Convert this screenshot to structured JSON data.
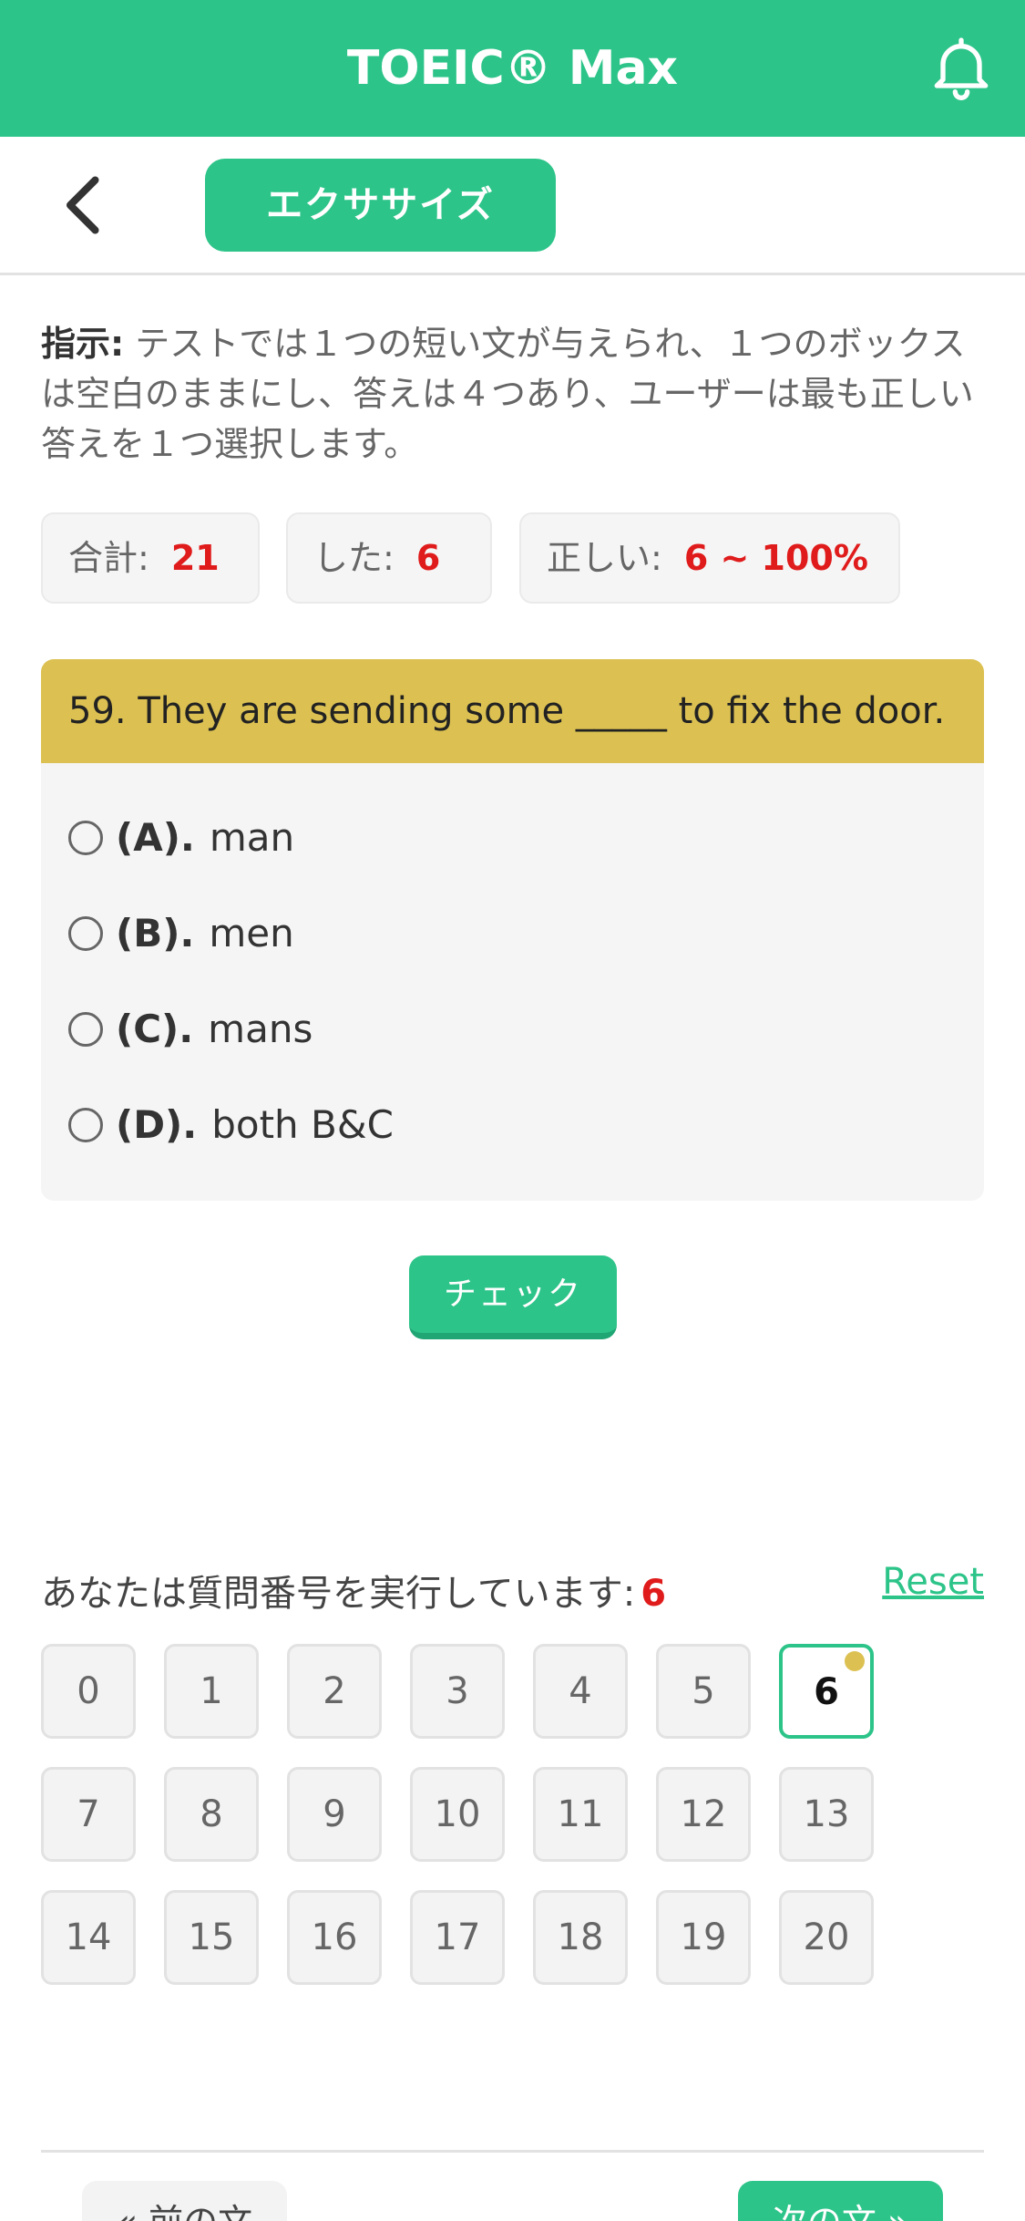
{
  "header": {
    "title": "TOEIC® Max",
    "icon": "bell-icon"
  },
  "subbar": {
    "back_icon": "chevron-left-icon",
    "mode_label": "エクササイズ"
  },
  "instruction": {
    "label": "指示:",
    "text": " テストでは１つの短い文が与えられ、１つのボックスは空白のままにし、答えは４つあり、ユーザーは最も正しい答えを１つ選択します。"
  },
  "stats": {
    "total_label": "合計:",
    "total_value": "21",
    "done_label": "した:",
    "done_value": "6",
    "correct_label": "正しい:",
    "correct_value": "6 ~ 100%"
  },
  "question": {
    "text": "59. They are sending some _____ to fix the door.",
    "options": [
      {
        "letter": "(A).",
        "text": "man"
      },
      {
        "letter": "(B).",
        "text": "men"
      },
      {
        "letter": "(C).",
        "text": "mans"
      },
      {
        "letter": "(D).",
        "text": "both B&C"
      }
    ]
  },
  "check_label": "チェック",
  "progress": {
    "label": "あなたは質問番号を実行しています:",
    "current": "6",
    "reset_label": "Reset",
    "numbers": [
      "0",
      "1",
      "2",
      "3",
      "4",
      "5",
      "6",
      "7",
      "8",
      "9",
      "10",
      "11",
      "12",
      "13",
      "14",
      "15",
      "16",
      "17",
      "18",
      "19",
      "20"
    ]
  },
  "nav": {
    "prev_label": "« 前の文",
    "next_label": "次の文 »"
  },
  "colors": {
    "primary": "#2dc489",
    "question_bar": "#dcc152",
    "accent_red": "#e01b1b"
  }
}
